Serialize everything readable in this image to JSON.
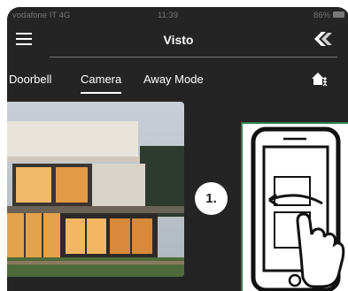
{
  "status_bar": {
    "carrier": "vodafone IT  4G",
    "time": "11:39",
    "right_status": "86%"
  },
  "header": {
    "title": "Visto",
    "menu_icon": "hamburger-menu-icon",
    "brand_icon": "brand-logo-icon"
  },
  "tabs": [
    {
      "label": "Doorbell",
      "active": false
    },
    {
      "label": "Camera",
      "active": true
    },
    {
      "label": "Away Mode",
      "active": false
    }
  ],
  "away_icon": "home-person-icon",
  "camera_view": {
    "icon": "camera-feed-image"
  },
  "instruction": {
    "step": "1.",
    "gesture_icon": "swipe-gesture-icon"
  },
  "colors": {
    "background": "#242424",
    "text": "#ffffff",
    "panel_border": "#2e7d4c",
    "badge": "#ffffff"
  }
}
